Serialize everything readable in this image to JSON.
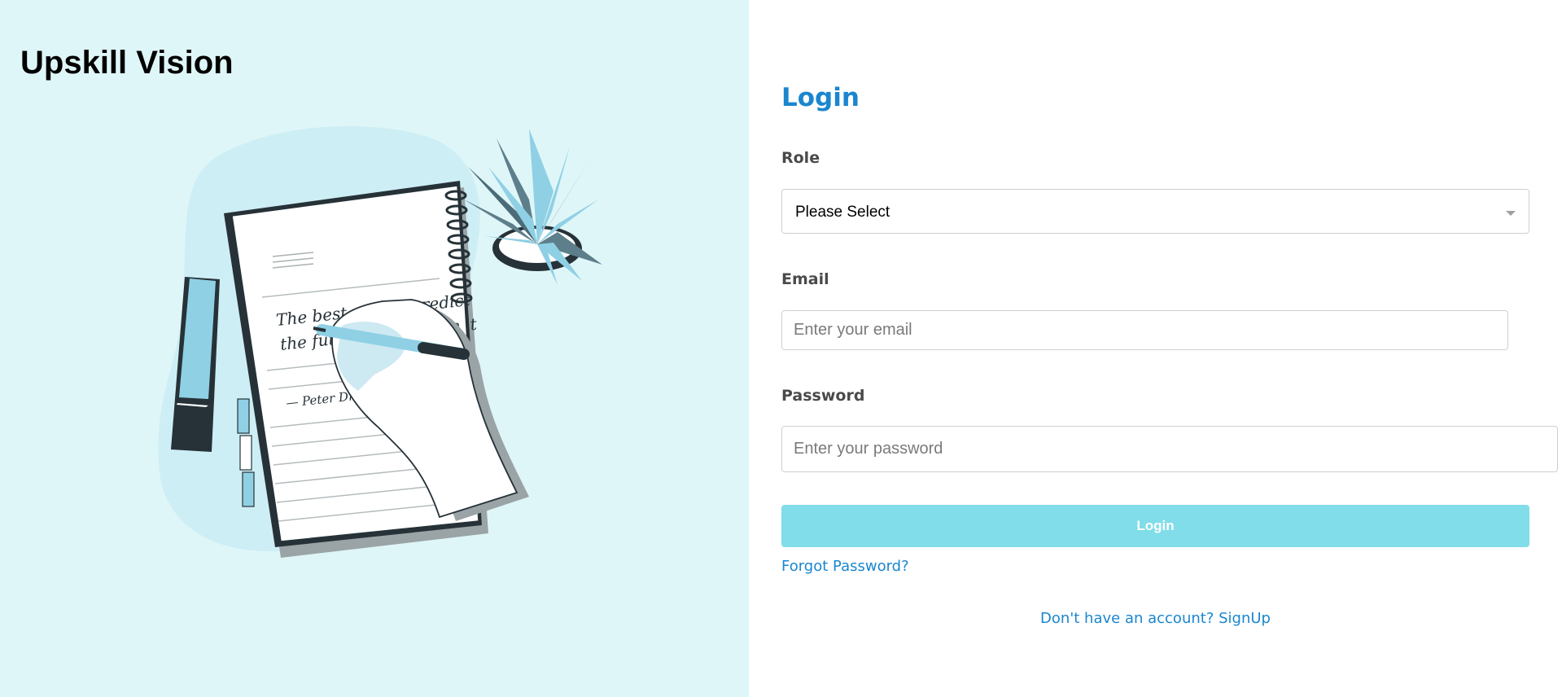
{
  "brand": {
    "name": "Upskill Vision"
  },
  "illustration": {
    "quote_line1": "The best way to predict",
    "quote_line2": "the future is to create it",
    "signature": "— Peter Drucker"
  },
  "form": {
    "title": "Login",
    "role": {
      "label": "Role",
      "selected": "Please Select"
    },
    "email": {
      "label": "Email",
      "placeholder": "Enter your email",
      "value": ""
    },
    "password": {
      "label": "Password",
      "placeholder": "Enter your password",
      "value": ""
    },
    "submit_label": "Login",
    "forgot_label": "Forgot Password?",
    "signup_prompt": "Don't have an account? SignUp"
  },
  "colors": {
    "left_panel_bg": "#dff6f8",
    "accent_blue": "#1a86cf",
    "button_bg": "#80dde9",
    "illustration_blue": "#8fd0e5",
    "illustration_dark": "#263238"
  },
  "icons": {
    "select_caret": "chevron-down-icon"
  }
}
